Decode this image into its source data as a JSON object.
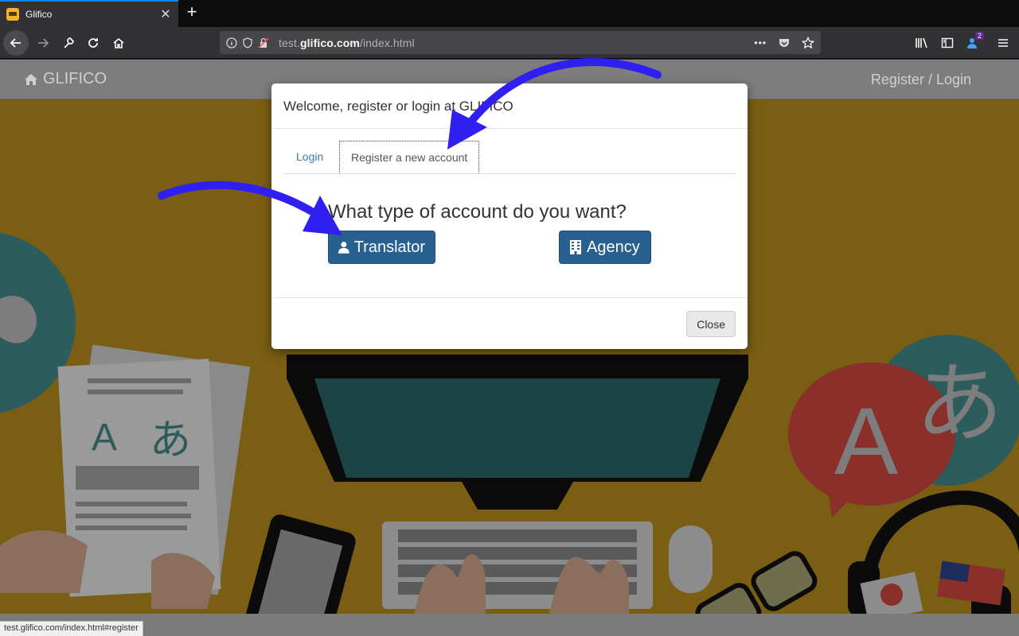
{
  "browser": {
    "tab_title": "Glifico",
    "tab_close": "✕",
    "new_tab": "+",
    "url_prefix": "test.",
    "url_host": "glifico.com",
    "url_path": "/index.html",
    "more": "•••",
    "badge_count": "2"
  },
  "site": {
    "brand": "GLIFICO",
    "nav_link": "Register / Login"
  },
  "modal": {
    "title": "Welcome, register or login at GLIFICO",
    "tabs": [
      {
        "label": "Login"
      },
      {
        "label": "Register a new account"
      }
    ],
    "question": "What type of account do you want?",
    "translator_label": "Translator",
    "agency_label": "Agency",
    "close_label": "Close"
  },
  "illustration": {
    "letter_a_left": "A",
    "kana_left": "あ",
    "letter_a_right": "A",
    "kana_right": "あ"
  },
  "status_url": "test.glifico.com/index.html#register",
  "colors": {
    "accent": "#0a84ff",
    "primary_button": "#286090",
    "background_mustard": "#c7a12b",
    "arrow": "#2f1ff0"
  }
}
